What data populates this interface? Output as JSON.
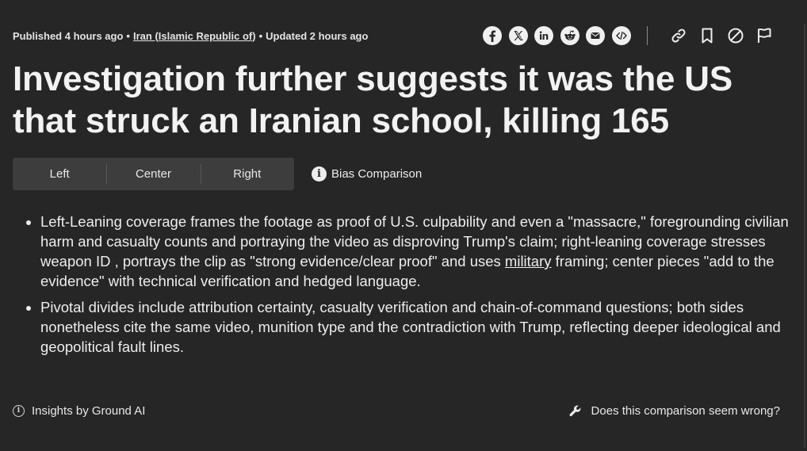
{
  "meta": {
    "published": "Published 4 hours ago",
    "separator": "•",
    "region": "Iran (Islamic Republic of)",
    "updated": "Updated 2 hours ago"
  },
  "share": [
    "facebook-icon",
    "x-icon",
    "linkedin-icon",
    "reddit-icon",
    "email-icon",
    "embed-icon"
  ],
  "tools": [
    "link-icon",
    "bookmark-icon",
    "block-icon",
    "flag-icon"
  ],
  "headline": "Investigation further suggests it was the US that struck an Iranian school, killing 165",
  "tabs": {
    "left": "Left",
    "center": "Center",
    "right": "Right"
  },
  "bias_comparison": {
    "icon_glyph": "i",
    "label": "Bias Comparison"
  },
  "bullets": {
    "first_before": "Left-Leaning coverage frames the footage as proof of U.S. culpability and even a \"massacre,\" foregrounding civilian harm and casualty counts and portraying the video as disproving Trump's claim; right-leaning coverage stresses weapon ID , portrays the clip as \"strong evidence/clear proof\" and uses ",
    "first_link": "military",
    "first_after": " framing; center pieces \"add to the evidence\" with technical verification and hedged language.",
    "second": "Pivotal divides include attribution certainty, casualty verification and chain-of-command questions; both sides nonetheless cite the same video, munition type and the contradiction with Trump, reflecting deeper ideological and geopolitical fault lines."
  },
  "footer": {
    "insights": "Insights by Ground AI",
    "info_glyph": "i",
    "report": "Does this comparison seem wrong?"
  },
  "colors": {
    "background": "#262626",
    "text": "#ededed",
    "tab_background": "#3d3d3d"
  }
}
